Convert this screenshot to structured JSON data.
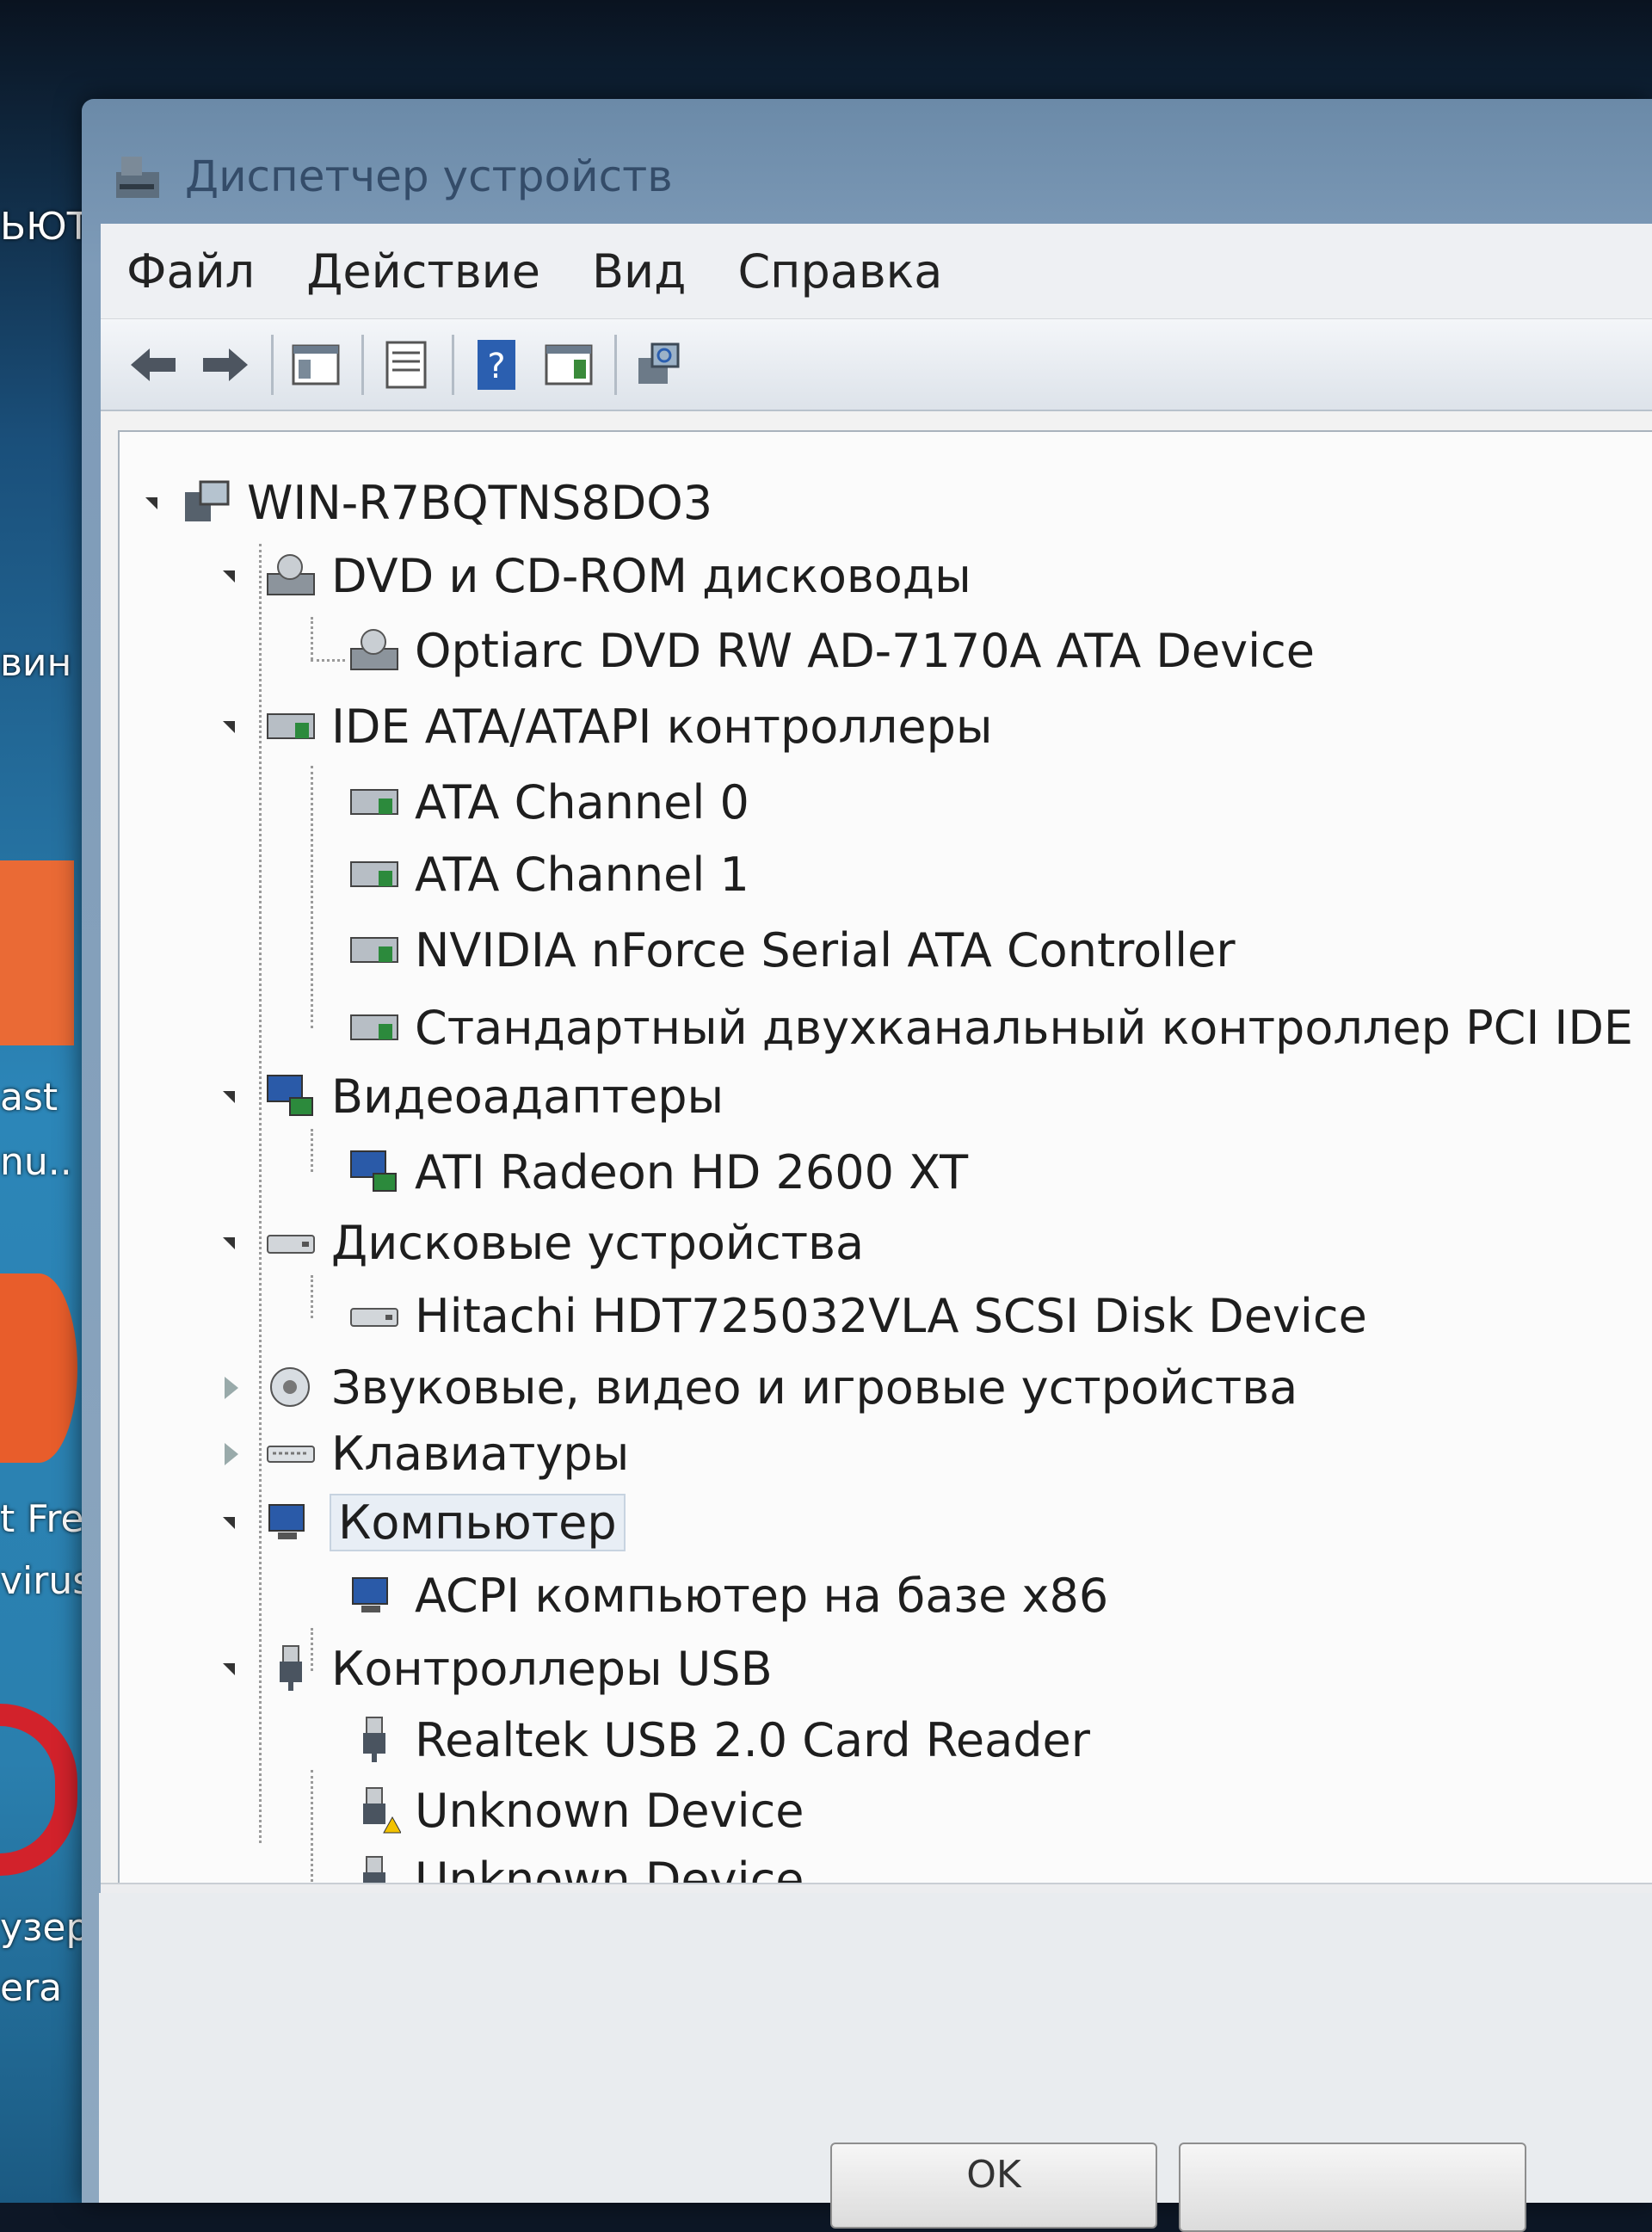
{
  "window": {
    "title": "Диспетчер устройств"
  },
  "menu": [
    "Файл",
    "Действие",
    "Вид",
    "Справка"
  ],
  "toolbar": {
    "buttons": [
      "back-icon",
      "forward-icon",
      "console-tree-icon",
      "properties-icon",
      "help-icon",
      "action-pane-icon",
      "scan-hardware-icon"
    ]
  },
  "tree": {
    "root": "WIN-R7BQTNS8DO3",
    "categories": [
      {
        "label": "DVD и CD-ROM дисководы",
        "expanded": true,
        "children": [
          "Optiarc DVD RW AD-7170A ATA Device"
        ]
      },
      {
        "label": "IDE ATA/ATAPI контроллеры",
        "expanded": true,
        "children": [
          "ATA Channel 0",
          "ATA Channel 1",
          "NVIDIA nForce Serial ATA Controller",
          "Стандартный двухканальный контроллер PCI IDE"
        ]
      },
      {
        "label": "Видеоадаптеры",
        "expanded": true,
        "children": [
          "ATI Radeon HD 2600 XT"
        ]
      },
      {
        "label": "Дисковые устройства",
        "expanded": true,
        "children": [
          "Hitachi HDT725032VLA SCSI Disk Device"
        ]
      },
      {
        "label": "Звуковые, видео и игровые устройства",
        "expanded": false,
        "children": []
      },
      {
        "label": "Клавиатуры",
        "expanded": false,
        "children": []
      },
      {
        "label": "Компьютер",
        "expanded": true,
        "children": [
          "ACPI компьютер на базе x86"
        ]
      },
      {
        "label": "Контроллеры USB",
        "expanded": true,
        "children": [
          "Realtek USB 2.0 Card Reader",
          "Unknown Device",
          "Unknown Device"
        ]
      }
    ]
  },
  "desktop_labels": [
    "ЬЮТ",
    "вин",
    "ast",
    "nu..",
    "t Fre",
    "virus",
    "узер",
    "era"
  ],
  "dialog": {
    "ok_label": "OK"
  },
  "colors": {
    "warning": "#f2c200",
    "desktop": "#2c86b8",
    "accent_orange": "#ea6a35",
    "opera_red": "#d2222b"
  }
}
